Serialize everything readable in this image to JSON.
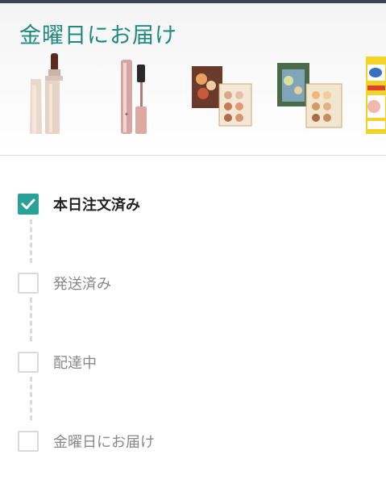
{
  "header": {
    "title": "金曜日にお届け"
  },
  "products": [
    {
      "icon": "lip-gloss-icon"
    },
    {
      "icon": "mascara-icon"
    },
    {
      "icon": "eyeshadow-palette-icon"
    },
    {
      "icon": "eyeshadow-palette-icon"
    },
    {
      "icon": "product-box-icon"
    }
  ],
  "timeline": {
    "steps": [
      {
        "label": "本日注文済み",
        "completed": true
      },
      {
        "label": "発送済み",
        "completed": false
      },
      {
        "label": "配達中",
        "completed": false
      },
      {
        "label": "金曜日にお届け",
        "completed": false
      }
    ]
  },
  "colors": {
    "accent": "#2aa198",
    "title": "#1f8a80",
    "inactive": "#d9d9d9"
  }
}
